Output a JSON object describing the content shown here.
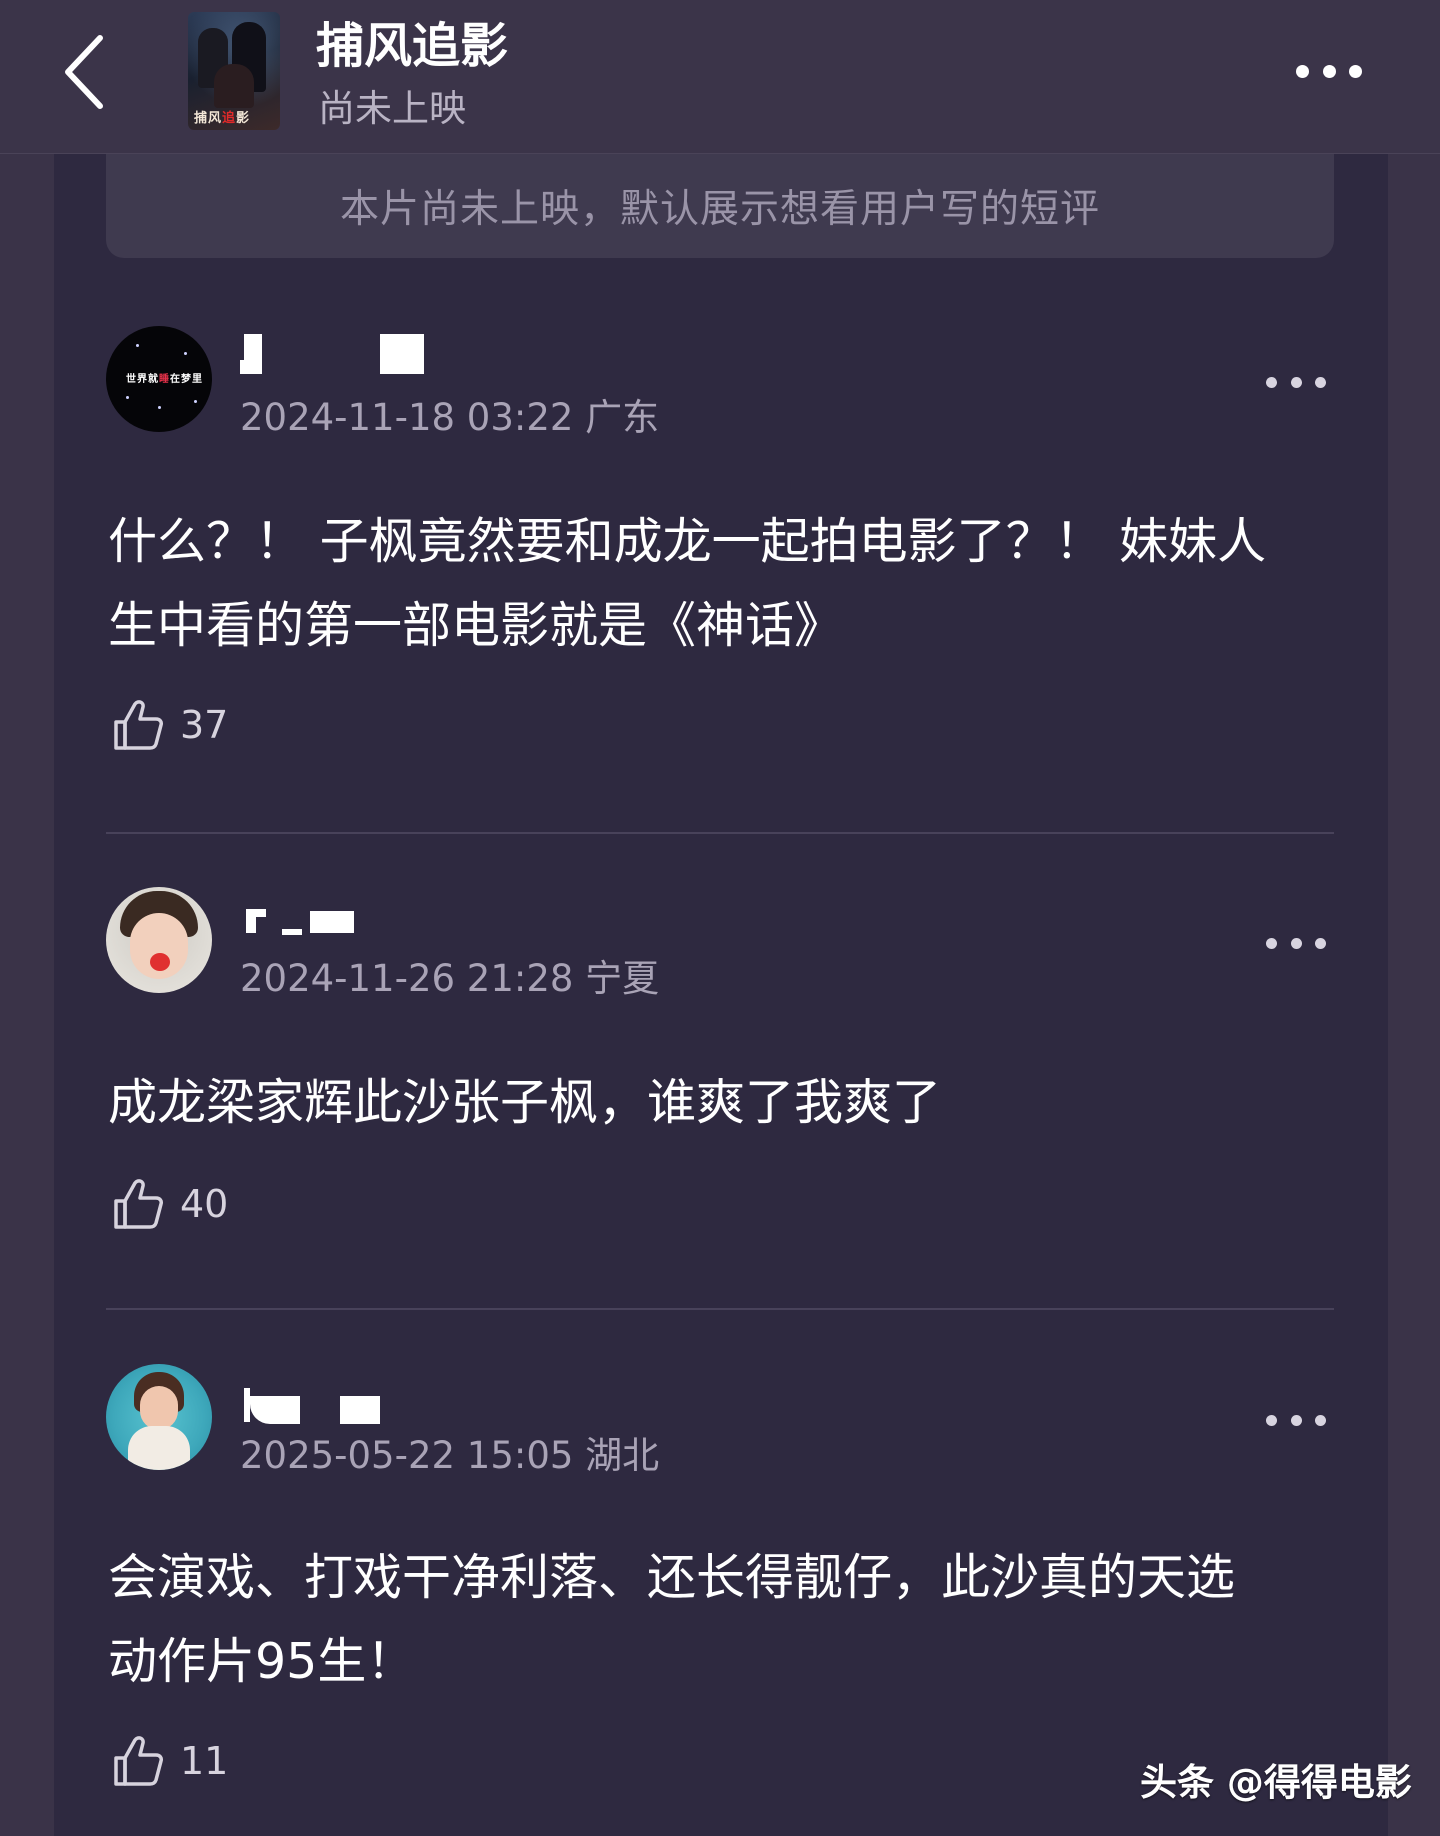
{
  "header": {
    "title": "捕风追影",
    "subtitle": "尚未上映",
    "poster_text_a": "捕风",
    "poster_text_b": "追",
    "poster_text_c": "影"
  },
  "notice": "本片尚未上映，默认展示想看用户写的短评",
  "comments": [
    {
      "meta": "2024-11-18 03:22 广东",
      "avatar_text_a": "世界就",
      "avatar_text_b": "睡",
      "avatar_text_c": "在梦里",
      "text_line1": "什么？！ 子枫竟然要和成龙一起拍电影了？！ 妹妹人",
      "text_line2": "生中看的第一部电影就是《神话》",
      "likes": "37"
    },
    {
      "meta": "2024-11-26 21:28 宁夏",
      "text_line1": "成龙梁家辉此沙张子枫，谁爽了我爽了",
      "likes": "40"
    },
    {
      "meta": "2025-05-22 15:05 湖北",
      "text_line1": "会演戏、打戏干净利落、还长得靓仔，此沙真的天选",
      "text_line2": "动作片95生！",
      "likes": "11"
    }
  ],
  "watermark": "头条 @得得电影",
  "colors": {
    "background": "#3a3348",
    "panel": "#2e2940",
    "notice_bg": "#3f3a4f",
    "meta_text": "#a9a3b6"
  }
}
